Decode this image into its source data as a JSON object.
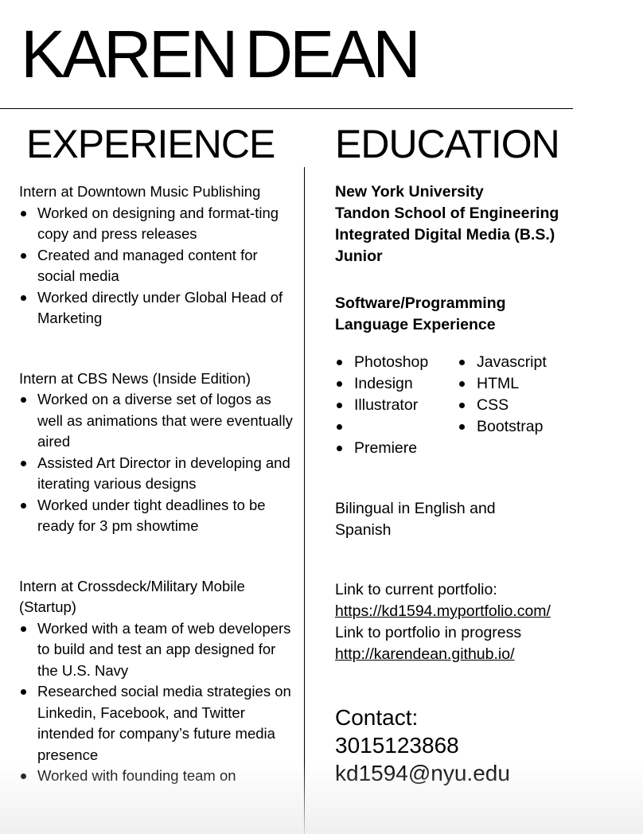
{
  "header": {
    "first_name": "KAREN",
    "last_name": "DEAN"
  },
  "experience": {
    "title": "EXPERIENCE",
    "jobs": [
      {
        "title": "Intern at Downtown Music Publishing",
        "bullets": [
          "Worked on designing and format-ting copy and press releases",
          "Created and managed content for social media",
          "Worked directly under Global Head of Marketing"
        ]
      },
      {
        "title": "Intern at CBS News (Inside Edition)",
        "bullets": [
          "Worked on a diverse set of logos as well as animations that were eventually aired",
          "Assisted Art Director in developing and iterating various designs",
          "Worked under tight deadlines to be ready for 3 pm showtime"
        ]
      },
      {
        "title": "Intern at Crossdeck/Military Mobile (Startup)",
        "bullets": [
          "Worked with a team of web developers to build and test an app designed for the U.S. Navy",
          "Researched social media strategies on Linkedin, Facebook, and Twitter intended for company’s future media presence",
          "Worked with founding team on"
        ]
      }
    ]
  },
  "education": {
    "title": "EDUCATION",
    "school_lines": [
      "New York University",
      "Tandon School of Engineering",
      "Integrated Digital Media (B.S.)",
      "Junior"
    ],
    "software_heading_lines": [
      "Software/Programming",
      "Language Experience"
    ],
    "skills_col1": [
      "Photoshop",
      "Indesign",
      "Illustrator",
      "",
      "Premiere"
    ],
    "skills_col2": [
      "Javascript",
      "HTML",
      "CSS",
      "Bootstrap"
    ],
    "bilingual": "Bilingual in English and Spanish",
    "portfolio_label": "Link to current portfolio:",
    "portfolio_url": "https://kd1594.myportfolio.com/",
    "progress_label": "Link to portfolio in progress",
    "progress_url": "http://karendean.github.io/",
    "contact_label": "Contact:",
    "phone": "3015123868",
    "email": "kd1594@nyu.edu"
  }
}
